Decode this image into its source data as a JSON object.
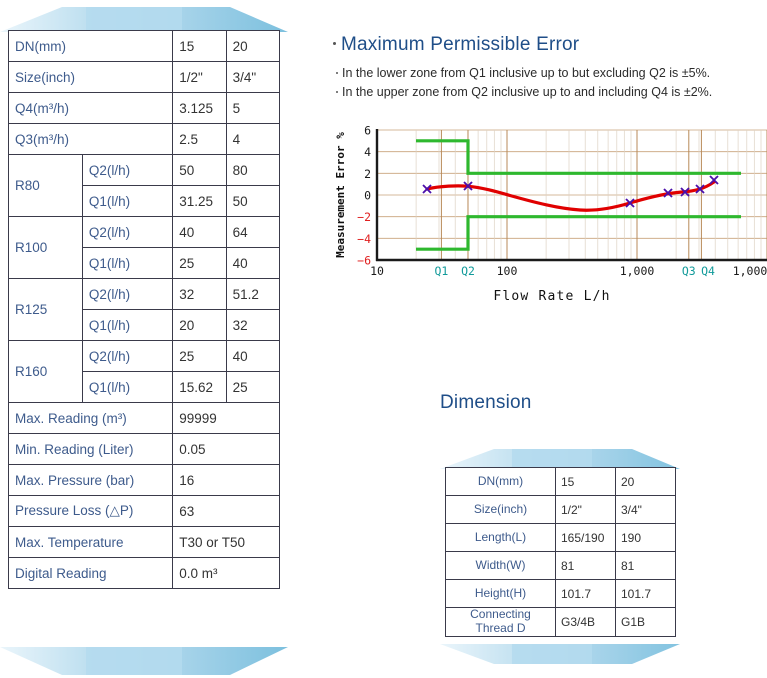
{
  "spec_table": {
    "rows": [
      {
        "type": "span2",
        "label": "DN(mm)",
        "v1": "15",
        "v2": "20"
      },
      {
        "type": "span2",
        "label": "Size(inch)",
        "v1": "1/2\"",
        "v2": "3/4\""
      },
      {
        "type": "span2",
        "label": "Q4(m³/h)",
        "v1": "3.125",
        "v2": "5"
      },
      {
        "type": "span2",
        "label": "Q3(m³/h)",
        "v1": "2.5",
        "v2": "4"
      },
      {
        "type": "group_first",
        "group": "R80",
        "label": "Q2(l/h)",
        "v1": "50",
        "v2": "80"
      },
      {
        "type": "group_second",
        "label": "Q1(l/h)",
        "v1": "31.25",
        "v2": "50"
      },
      {
        "type": "group_first",
        "group": "R100",
        "label": "Q2(l/h)",
        "v1": "40",
        "v2": "64"
      },
      {
        "type": "group_second",
        "label": "Q1(l/h)",
        "v1": "25",
        "v2": "40"
      },
      {
        "type": "group_first",
        "group": "R125",
        "label": "Q2(l/h)",
        "v1": "32",
        "v2": "51.2"
      },
      {
        "type": "group_second",
        "label": "Q1(l/h)",
        "v1": "20",
        "v2": "32"
      },
      {
        "type": "group_first",
        "group": "R160",
        "label": "Q2(l/h)",
        "v1": "25",
        "v2": "40"
      },
      {
        "type": "group_second",
        "label": "Q1(l/h)",
        "v1": "15.62",
        "v2": "25"
      },
      {
        "type": "wide",
        "label": "Max. Reading (m³)",
        "value": "99999"
      },
      {
        "type": "wide",
        "label": "Min. Reading (Liter)",
        "value": "0.05"
      },
      {
        "type": "wide",
        "label": "Max. Pressure (bar)",
        "value": "16"
      },
      {
        "type": "wide",
        "label": "Pressure Loss (△P)",
        "value": "63"
      },
      {
        "type": "wide",
        "label": "Max. Temperature",
        "value": "T30 or T50"
      },
      {
        "type": "wide",
        "label": "Digital Reading",
        "value": "0.0 m³"
      }
    ]
  },
  "mpe": {
    "title": "Maximum Permissible Error",
    "line1": "In the lower zone from Q1 inclusive up to but excluding Q2 is ±5%.",
    "line2": "In the upper zone from Q2 inclusive up to and including Q4 is ±2%."
  },
  "dimension": {
    "title": "Dimension",
    "rows": [
      {
        "label": "DN(mm)",
        "v1": "15",
        "v2": "20"
      },
      {
        "label": "Size(inch)",
        "v1": "1/2\"",
        "v2": "3/4\""
      },
      {
        "label": "Length(L)",
        "v1": "165/190",
        "v2": "190"
      },
      {
        "label": "Width(W)",
        "v1": "81",
        "v2": "81"
      },
      {
        "label": "Height(H)",
        "v1": "101.7",
        "v2": "101.7"
      },
      {
        "label": "Connecting\nThread D",
        "v1": "G3/4B",
        "v2": "G1B"
      }
    ]
  },
  "colors": {
    "label_blue": "#3e5b8c",
    "title_navy": "#1f4e88",
    "curve_red": "#e00000",
    "limit_green": "#2eb82e",
    "marker_purple": "#4b0faa",
    "grid_tan": "#c8a27a",
    "axis_black": "#1a1a1a",
    "neg_tick_red": "#e02020",
    "banner_light": "#e3f1f9",
    "banner_mid": "#a8d4ea",
    "banner_dark": "#7cc0de"
  },
  "chart_data": {
    "type": "line",
    "title": "",
    "xlabel": "Flow Rate L/h",
    "ylabel": "Measurement Error %",
    "x_scale": "log",
    "xlim": [
      10,
      10000
    ],
    "ylim": [
      -6,
      6
    ],
    "yticks": [
      -6,
      -4,
      -2,
      0,
      2,
      4,
      6
    ],
    "ytick_labels": [
      "-6",
      "-4",
      "-2",
      "0",
      "2",
      "4",
      "6"
    ],
    "xtick_labels": [
      "10",
      "Q1",
      "Q2",
      "100",
      "1,000",
      "Q3",
      "Q4",
      "1,000"
    ],
    "xtick_values": [
      10,
      31.25,
      50,
      100,
      1000,
      2500,
      3125,
      10000
    ],
    "grid": true,
    "legend": "none",
    "series": [
      {
        "name": "Measurement error curve",
        "color": "#e00000",
        "x": [
          25,
          31.25,
          50,
          100,
          300,
          500,
          700,
          1000,
          1800,
          2500,
          3125,
          4000
        ],
        "y": [
          0.55,
          0.75,
          0.8,
          0.55,
          0.0,
          -0.55,
          -0.8,
          -0.55,
          0.1,
          0.25,
          0.3,
          1.0
        ]
      },
      {
        "name": "Upper permissible limit",
        "color": "#2eb82e",
        "segments": [
          {
            "x_start": 20,
            "x_end": 50,
            "y": 5
          },
          {
            "x_start": 50,
            "x_end": 5000,
            "y": 2
          }
        ]
      },
      {
        "name": "Lower permissible limit",
        "color": "#2eb82e",
        "segments": [
          {
            "x_start": 20,
            "x_end": 50,
            "y": -5
          },
          {
            "x_start": 50,
            "x_end": 5000,
            "y": -2
          }
        ]
      }
    ],
    "markers": {
      "name": "Measured points",
      "symbol": "x",
      "color": "#4b0faa",
      "points": [
        {
          "x": 26,
          "y": 0.55
        },
        {
          "x": 50,
          "y": 0.72
        },
        {
          "x": 900,
          "y": -0.5
        },
        {
          "x": 1800,
          "y": 0.18
        },
        {
          "x": 2400,
          "y": 0.28
        },
        {
          "x": 3200,
          "y": 1.0
        }
      ]
    }
  }
}
